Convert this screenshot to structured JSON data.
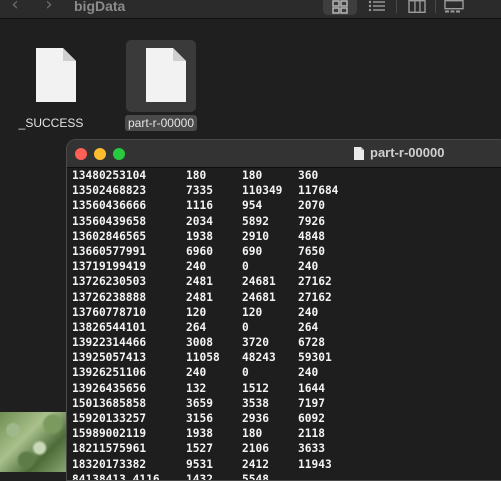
{
  "finder": {
    "title": "bigData",
    "toolbar": {
      "back_icon": "chevron-left-icon",
      "forward_icon": "chevron-right-icon",
      "view_icons": [
        "grid-view-icon",
        "list-view-icon",
        "column-view-icon",
        "gallery-view-icon"
      ],
      "selected_view": "grid-view-icon"
    },
    "files": [
      {
        "name": "_SUCCESS",
        "icon": "document-icon",
        "selected": false
      },
      {
        "name": "part-r-00000",
        "icon": "document-icon",
        "selected": true
      }
    ]
  },
  "viewer": {
    "title": "part-r-00000",
    "title_icon": "document-icon",
    "colors": {
      "close": "#fe5f57",
      "minimize": "#febc2e",
      "maximize": "#28c840"
    },
    "rows": [
      [
        "13480253104",
        "180",
        "180",
        "360"
      ],
      [
        "13502468823",
        "7335",
        "110349",
        "117684"
      ],
      [
        "13560436666",
        "1116",
        "954",
        "2070"
      ],
      [
        "13560439658",
        "2034",
        "5892",
        "7926"
      ],
      [
        "13602846565",
        "1938",
        "2910",
        "4848"
      ],
      [
        "13660577991",
        "6960",
        "690",
        "7650"
      ],
      [
        "13719199419",
        "240",
        "0",
        "240"
      ],
      [
        "13726230503",
        "2481",
        "24681",
        "27162"
      ],
      [
        "13726238888",
        "2481",
        "24681",
        "27162"
      ],
      [
        "13760778710",
        "120",
        "120",
        "240"
      ],
      [
        "13826544101",
        "264",
        "0",
        "264"
      ],
      [
        "13922314466",
        "3008",
        "3720",
        "6728"
      ],
      [
        "13925057413",
        "11058",
        "48243",
        "59301"
      ],
      [
        "13926251106",
        "240",
        "0",
        "240"
      ],
      [
        "13926435656",
        "132",
        "1512",
        "1644"
      ],
      [
        "15013685858",
        "3659",
        "3538",
        "7197"
      ],
      [
        "15920133257",
        "3156",
        "2936",
        "6092"
      ],
      [
        "15989002119",
        "1938",
        "180",
        "2118"
      ],
      [
        "18211575961",
        "1527",
        "2106",
        "3633"
      ],
      [
        "18320173382",
        "9531",
        "2412",
        "11943"
      ],
      [
        "84138413 4116",
        "1432",
        "5548",
        ""
      ]
    ]
  }
}
